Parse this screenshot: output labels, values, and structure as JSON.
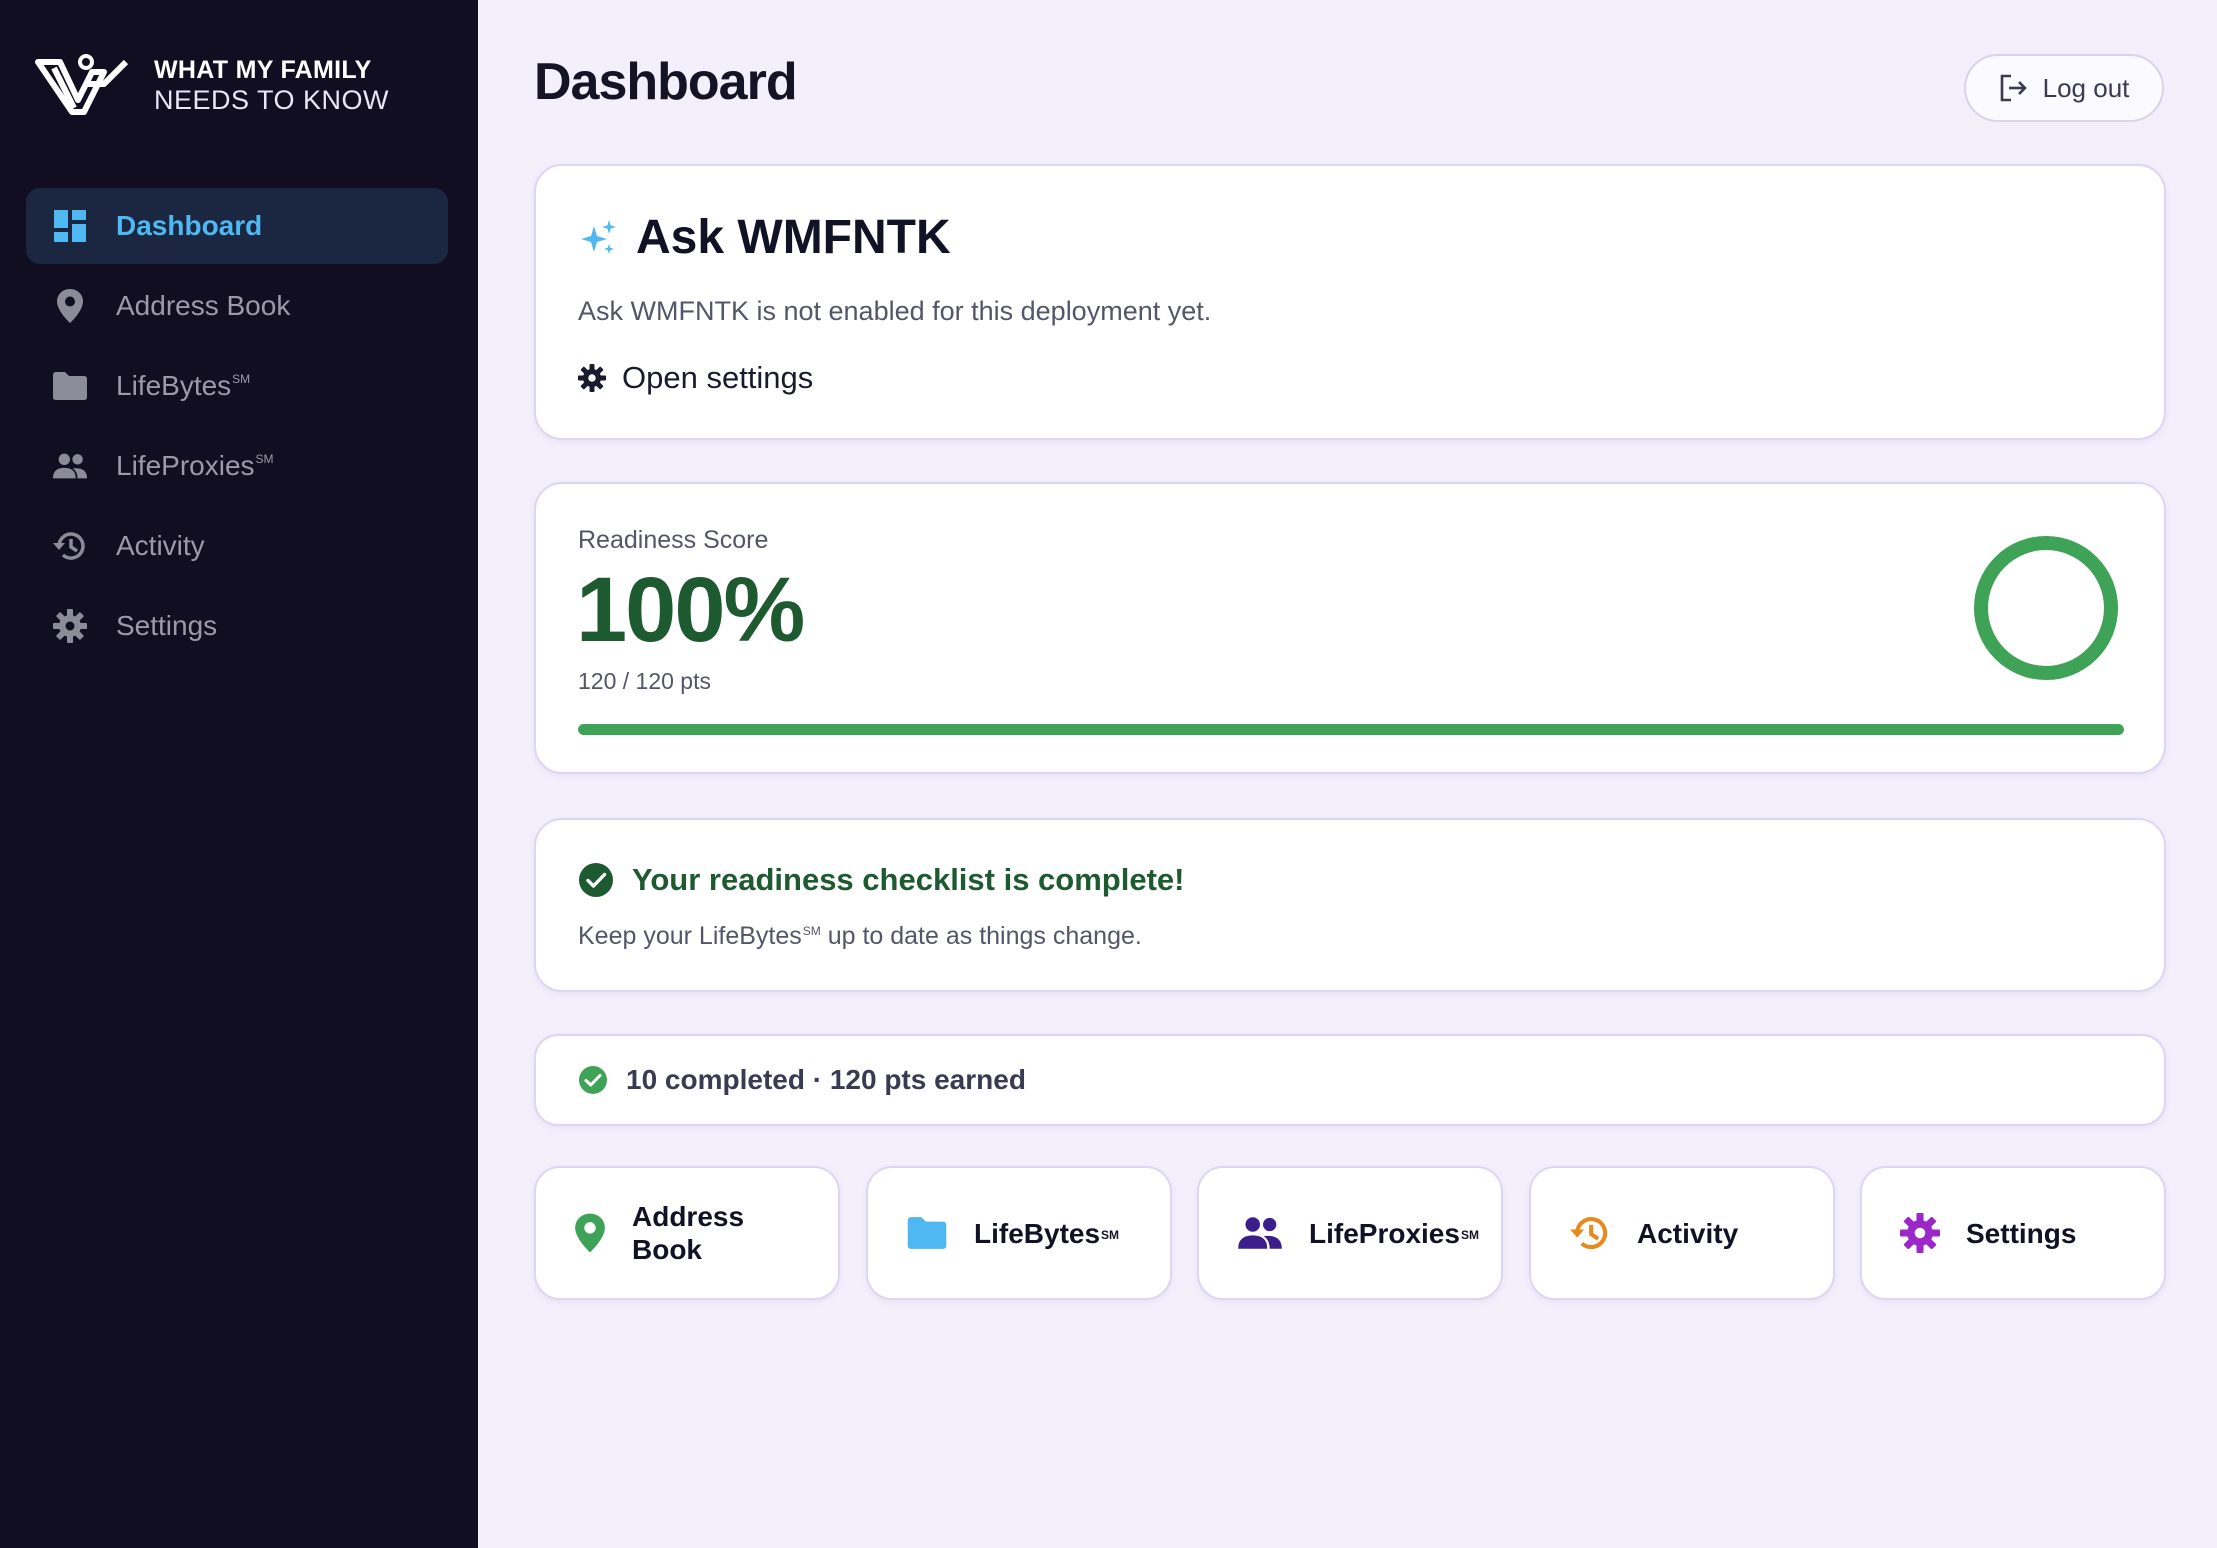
{
  "brand": {
    "line1": "WHAT MY FAMILY",
    "line2": "NEEDS TO KNOW"
  },
  "sidebar": {
    "items": [
      {
        "label": "Dashboard",
        "icon": "dashboard-icon",
        "active": true
      },
      {
        "label": "Address Book",
        "icon": "map-pin-icon"
      },
      {
        "label": "LifeBytes",
        "sup": "SM",
        "icon": "folder-icon"
      },
      {
        "label": "LifeProxies",
        "sup": "SM",
        "icon": "people-icon"
      },
      {
        "label": "Activity",
        "icon": "history-icon"
      },
      {
        "label": "Settings",
        "icon": "gear-icon"
      }
    ]
  },
  "header": {
    "title": "Dashboard",
    "logout_label": "Log out"
  },
  "ask": {
    "title": "Ask WMFNTK",
    "description": "Ask WMFNTK is not enabled for this deployment yet.",
    "settings_label": "Open settings"
  },
  "readiness": {
    "label": "Readiness Score",
    "value": "100%",
    "points": "120 / 120 pts",
    "progress": 1.0,
    "color": "#3fa357"
  },
  "checklist": {
    "title": "Your readiness checklist is complete!",
    "subtitle_pre": "Keep your LifeBytes",
    "subtitle_sup": "SM",
    "subtitle_post": " up to date as things change."
  },
  "stats": {
    "text": "10 completed · 120 pts earned"
  },
  "quick_links": [
    {
      "label": "Address Book",
      "icon": "map-pin-icon",
      "color": "#3fa357"
    },
    {
      "label": "LifeBytes",
      "sup": "SM",
      "icon": "folder-icon",
      "color": "#4fb8f2"
    },
    {
      "label": "LifeProxies",
      "sup": "SM",
      "icon": "people-icon",
      "color": "#3b1e8c"
    },
    {
      "label": "Activity",
      "icon": "history-icon",
      "color": "#e8891c"
    },
    {
      "label": "Settings",
      "icon": "gear-icon",
      "color": "#9b27c9"
    }
  ],
  "colors": {
    "sidebar_bg": "#110e21",
    "accent": "#4fb8f2",
    "success": "#1e5a30",
    "background": "#f3f0fc"
  }
}
